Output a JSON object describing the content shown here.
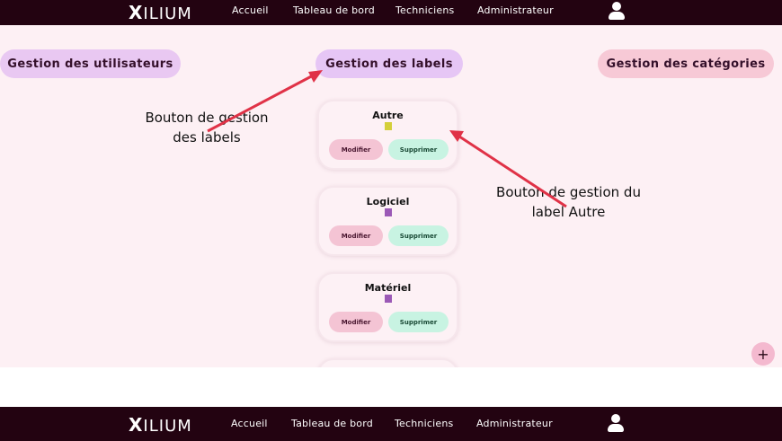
{
  "navbar": {
    "logo_mark": "X",
    "logo_text": "ILIUM",
    "links": [
      "Accueil",
      "Tableau de bord",
      "Techniciens",
      "Administrateur"
    ],
    "user_icon": "user-icon"
  },
  "tabs": {
    "users": "Gestion des utilisateurs",
    "labels": "Gestion des labels",
    "categories": "Gestion des catégories"
  },
  "labels": [
    {
      "name": "Autre",
      "color": "#d4cf3a",
      "modify": "Modifier",
      "delete": "Supprimer"
    },
    {
      "name": "Logiciel",
      "color": "#9b59b6",
      "modify": "Modifier",
      "delete": "Supprimer"
    },
    {
      "name": "Matériel",
      "color": "#9b59b6",
      "modify": "Modifier",
      "delete": "Supprimer"
    }
  ],
  "add_button": "+",
  "annotations": {
    "labels_button_line1": "Bouton de gestion",
    "labels_button_line2": "des labels",
    "autre_button_line1": "Bouton de gestion du",
    "autre_button_line2": "label Autre"
  },
  "colors": {
    "navbar": "#230311",
    "arrow": "#e03247",
    "background": "#fdf0f4"
  }
}
